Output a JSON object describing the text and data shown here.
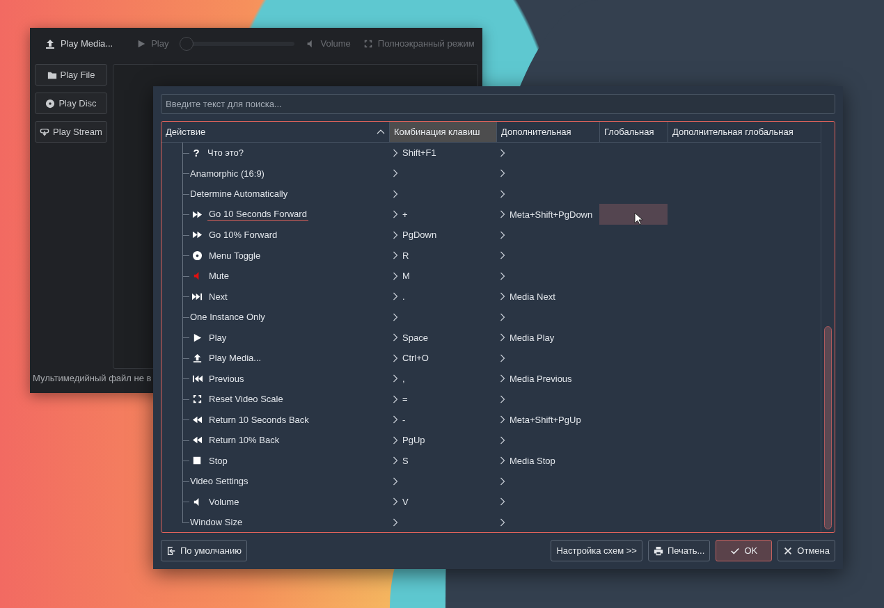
{
  "player": {
    "toolbar": [
      {
        "kind": "upload",
        "label": "Play Media...",
        "disabled": false
      },
      {
        "kind": "separator"
      },
      {
        "kind": "play",
        "label": "Play",
        "disabled": true
      },
      {
        "kind": "slider",
        "level": 0,
        "disabled": true
      },
      {
        "kind": "volume",
        "label": "Volume",
        "disabled": true
      },
      {
        "kind": "fullscreen",
        "label": "Полноэкранный режим",
        "disabled": true
      }
    ],
    "side_buttons": [
      {
        "kind": "folder",
        "label": "Play File"
      },
      {
        "kind": "disc",
        "label": "Play Disc"
      },
      {
        "kind": "stream",
        "label": "Play Stream"
      }
    ],
    "status_bar": "Мультимедийный файл не в"
  },
  "dialog": {
    "search": {
      "placeholder": "Введите текст для поиска..."
    },
    "columns": [
      {
        "label": "Действие",
        "sorted": true,
        "selected": false
      },
      {
        "label": "Комбинация клавиш",
        "sorted": false,
        "selected": true
      },
      {
        "label": "Дополнительная",
        "sorted": false,
        "selected": false
      },
      {
        "label": "Глобальная",
        "sorted": false,
        "selected": false
      },
      {
        "label": "Дополнительная глобальная",
        "sorted": false,
        "selected": false
      }
    ],
    "rows": [
      {
        "kind": "glyph",
        "glyph": "?",
        "name": "Что это?",
        "shortcut": "Shift+F1",
        "alternate": "",
        "current": false
      },
      {
        "kind": "none",
        "name": "Anamorphic (16:9)",
        "shortcut": "",
        "alternate": "",
        "current": false
      },
      {
        "kind": "none",
        "name": "Determine Automatically",
        "shortcut": "",
        "alternate": "",
        "current": false
      },
      {
        "kind": "forward",
        "name": "Go 10 Seconds Forward",
        "shortcut": "+",
        "alternate": "Meta+Shift+PgDown",
        "current": true
      },
      {
        "kind": "forward",
        "name": "Go 10% Forward",
        "shortcut": "PgDown",
        "alternate": "",
        "current": false
      },
      {
        "kind": "disc",
        "name": "Menu Toggle",
        "shortcut": "R",
        "alternate": "",
        "current": false
      },
      {
        "kind": "mute",
        "name": "Mute",
        "shortcut": "M",
        "alternate": "",
        "current": false
      },
      {
        "kind": "next",
        "name": "Next",
        "shortcut": ".",
        "alternate": "Media Next",
        "current": false
      },
      {
        "kind": "none",
        "name": "One Instance Only",
        "shortcut": "",
        "alternate": "",
        "current": false
      },
      {
        "kind": "play",
        "name": "Play",
        "shortcut": "Space",
        "alternate": "Media Play",
        "current": false
      },
      {
        "kind": "upload",
        "name": "Play Media...",
        "shortcut": "Ctrl+O",
        "alternate": "",
        "current": false
      },
      {
        "kind": "previous",
        "name": "Previous",
        "shortcut": ",",
        "alternate": "Media Previous",
        "current": false
      },
      {
        "kind": "fullscreen",
        "name": "Reset Video Scale",
        "shortcut": "=",
        "alternate": "",
        "current": false
      },
      {
        "kind": "rewind",
        "name": "Return 10 Seconds Back",
        "shortcut": "-",
        "alternate": "Meta+Shift+PgUp",
        "current": false
      },
      {
        "kind": "rewind",
        "name": "Return 10% Back",
        "shortcut": "PgUp",
        "alternate": "",
        "current": false
      },
      {
        "kind": "stop",
        "name": "Stop",
        "shortcut": "S",
        "alternate": "Media Stop",
        "current": false
      },
      {
        "kind": "none",
        "name": "Video Settings",
        "shortcut": "",
        "alternate": "",
        "current": false
      },
      {
        "kind": "volume",
        "name": "Volume",
        "shortcut": "V",
        "alternate": "",
        "current": false
      },
      {
        "kind": "none",
        "name": "Window Size",
        "shortcut": "",
        "alternate": "",
        "current": false
      }
    ],
    "left_buttons": [
      {
        "kind": "defaults",
        "label": "По умолчанию",
        "default": false
      }
    ],
    "right_buttons": [
      {
        "kind": "plain",
        "label": "Настройка схем >>",
        "default": false
      },
      {
        "kind": "print",
        "label": "Печать...",
        "default": false
      },
      {
        "kind": "ok",
        "label": "OK",
        "default": true
      },
      {
        "kind": "cancel",
        "label": "Отмена",
        "default": false
      }
    ]
  }
}
